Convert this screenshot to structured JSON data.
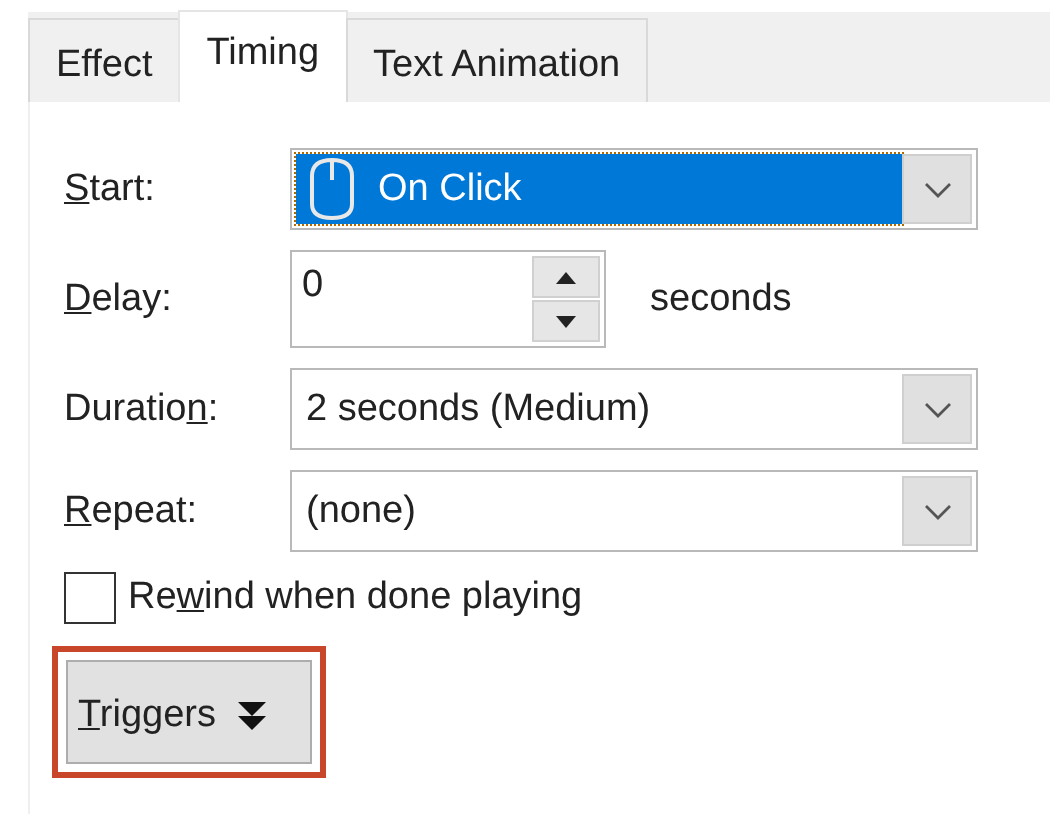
{
  "tabs": [
    {
      "label": "Effect",
      "selected": false
    },
    {
      "label": "Timing",
      "selected": true
    },
    {
      "label": "Text Animation",
      "selected": false
    }
  ],
  "rows": [
    {
      "kind": "dropdown",
      "access_key": "S",
      "label_after": "tart:",
      "value": "On Click",
      "focused": true,
      "show_mouse_icon": true
    },
    {
      "kind": "spin",
      "access_key": "D",
      "label_after": "elay:",
      "value": "0",
      "unit": "seconds"
    },
    {
      "kind": "dropdown",
      "label_before": "Duratio",
      "access_key": "n",
      "label_after": ":",
      "value": "2 seconds (Medium)",
      "focused": false
    },
    {
      "kind": "dropdown",
      "access_key": "R",
      "label_after": "epeat:",
      "value": "(none)",
      "focused": false
    }
  ],
  "rewind": {
    "label_before": "Re",
    "access_key": "w",
    "label_after": "ind when done playing",
    "checked": false
  },
  "triggers_button": {
    "access_key": "T",
    "label_after": "riggers",
    "highlighted": true
  }
}
